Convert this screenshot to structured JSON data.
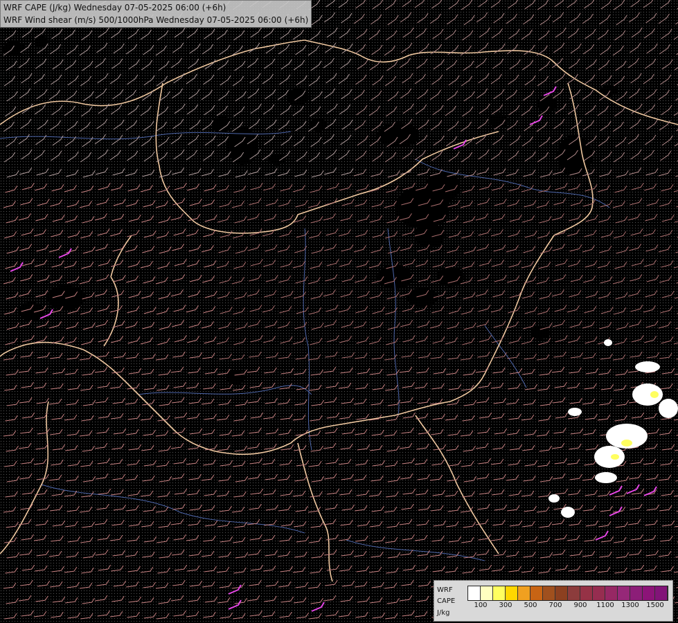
{
  "header": {
    "line1": "WRF CAPE (J/kg) Wednesday 07-05-2025 06:00 (+6h)",
    "line2": "WRF Wind shear (m/s) 500/1000hPa Wednesday 07-05-2025 06:00 (+6h)"
  },
  "legend": {
    "label_lines": [
      "WRF",
      "CAPE",
      "J/kg"
    ],
    "ticks": [
      "100",
      "300",
      "500",
      "700",
      "900",
      "1100",
      "1300",
      "1500"
    ],
    "colors": [
      "#ffffff",
      "#ffffc0",
      "#ffff60",
      "#ffd700",
      "#f0a020",
      "#c86414",
      "#a0501e",
      "#8c4020",
      "#8c3c3c",
      "#963246",
      "#962d50",
      "#962864",
      "#962878",
      "#8c1e78",
      "#8c1478",
      "#821478"
    ]
  },
  "map": {
    "background": "#000000",
    "dot_color": "#5a5a5a",
    "border_color": "#f0c8a0",
    "river_color": "#5a78c8",
    "barb_colors": [
      "#b4a0a0",
      "#b48c8c",
      "#c88282",
      "#aa6e6e",
      "#dc82b4"
    ],
    "highlight_color": "#e646e6",
    "cape_patch_colors": [
      "#ffffff",
      "#ffff60"
    ]
  }
}
